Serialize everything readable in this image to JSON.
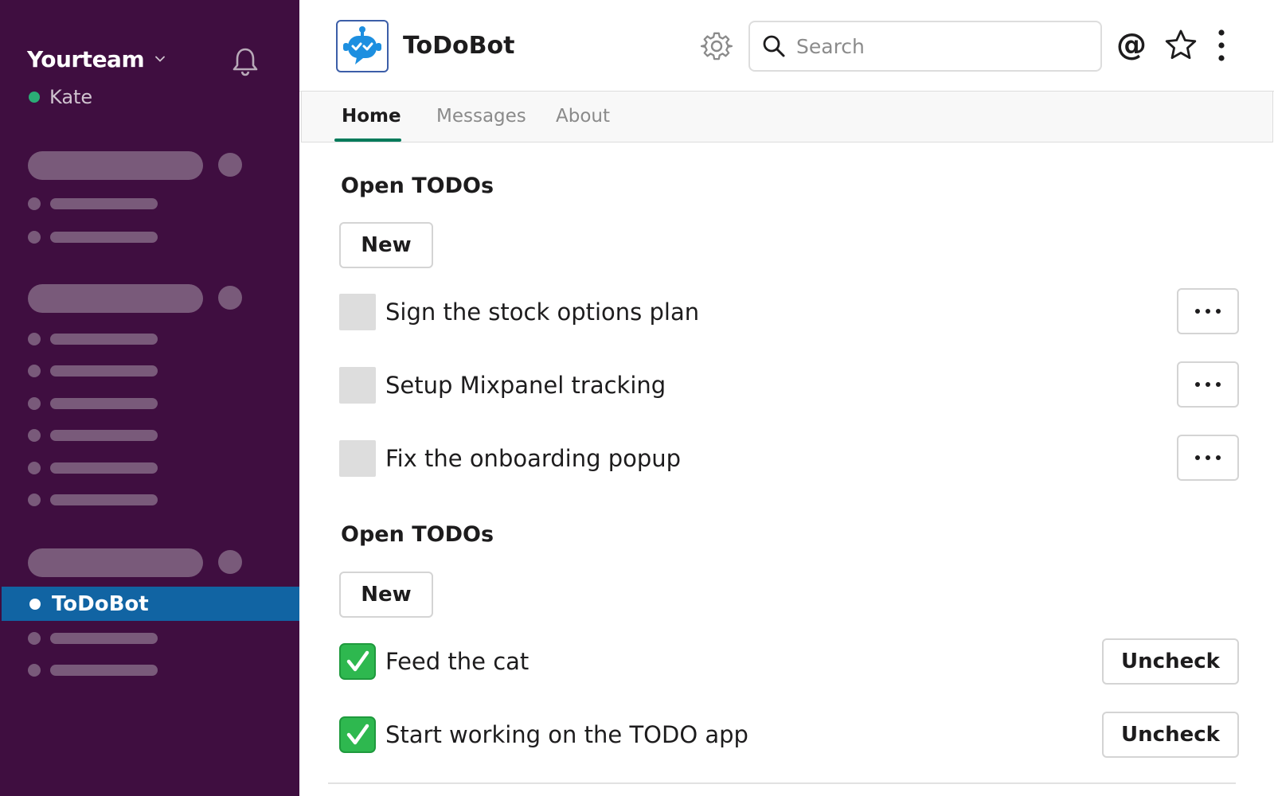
{
  "sidebar": {
    "team_name": "Yourteam",
    "user_name": "Kate",
    "active_item": "ToDoBot"
  },
  "header": {
    "app_title": "ToDoBot",
    "search_placeholder": "Search",
    "at_symbol": "@"
  },
  "tabs": {
    "home": "Home",
    "messages": "Messages",
    "about": "About"
  },
  "sections": [
    {
      "title": "Open TODOs",
      "new_label": "New",
      "items": [
        {
          "text": "Sign the stock options plan"
        },
        {
          "text": "Setup Mixpanel tracking"
        },
        {
          "text": "Fix the onboarding popup"
        }
      ]
    },
    {
      "title": "Open TODOs",
      "new_label": "New",
      "items": [
        {
          "text": "Feed the cat",
          "action": "Uncheck"
        },
        {
          "text": "Start working on the TODO app",
          "action": "Uncheck"
        }
      ]
    }
  ],
  "colors": {
    "sidebar_bg": "#3f0e40",
    "active_item_bg": "#1164a3",
    "presence_green": "#2bac76",
    "tab_underline": "#007a5a",
    "checked_green": "#2eb84f"
  }
}
